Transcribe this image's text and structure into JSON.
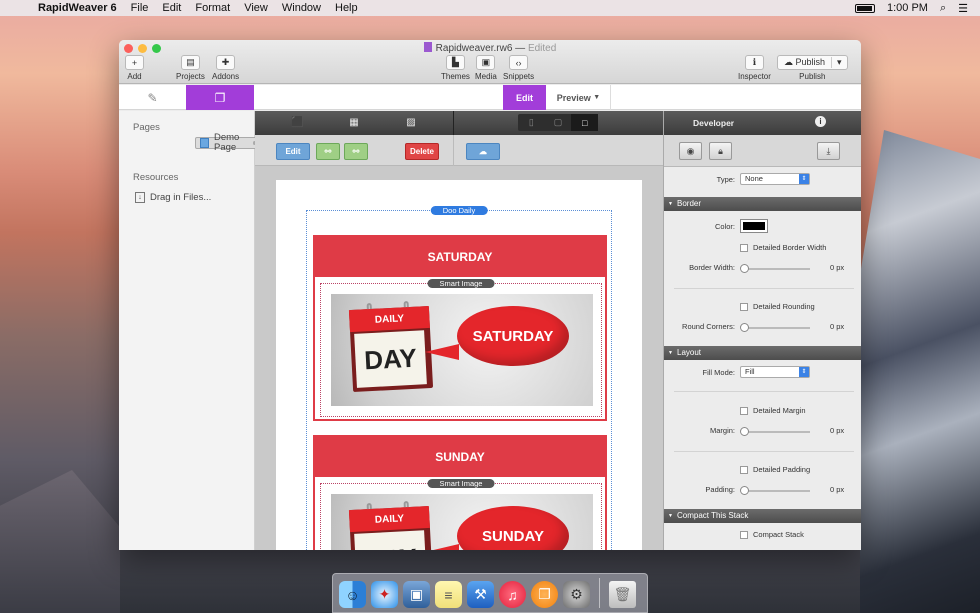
{
  "menubar": {
    "app_name": "RapidWeaver 6",
    "items": [
      "File",
      "Edit",
      "Format",
      "View",
      "Window",
      "Help"
    ],
    "clock": "1:00 PM"
  },
  "window": {
    "title": "Rapidweaver.rw6",
    "title_sep": "—",
    "edited": "Edited",
    "toolbar": {
      "add": "Add",
      "projects": "Projects",
      "addons": "Addons",
      "themes": "Themes",
      "media": "Media",
      "snippets": "Snippets",
      "inspector": "Inspector",
      "publish_button": "Publish",
      "publish_label": "Publish"
    },
    "mode_tabs": {
      "edit": "Edit",
      "preview": "Preview"
    }
  },
  "sidebar": {
    "pages_header": "Pages",
    "pages": [
      {
        "label": "Demo Page"
      }
    ],
    "resources_header": "Resources",
    "resources": [
      {
        "label": "Drag in Files..."
      }
    ]
  },
  "editor": {
    "actions": {
      "edit": "Edit",
      "delete": "Delete"
    },
    "stack_label": "Doo Daily",
    "cards": [
      {
        "title": "SATURDAY",
        "image_label": "Smart Image",
        "cal_top": "DAILY",
        "cal_word": "DAY",
        "bubble": "SATURDAY"
      },
      {
        "title": "SUNDAY",
        "image_label": "Smart Image",
        "cal_top": "DAILY",
        "cal_word": "DAY",
        "bubble": "SUNDAY"
      }
    ]
  },
  "inspector": {
    "header": "Developer",
    "type_label": "Type:",
    "type_value": "None",
    "border_section": "Border",
    "color_label": "Color:",
    "border_color": "#000000",
    "detailed_border_width": "Detailed Border Width",
    "border_width_label": "Border Width:",
    "border_width_value": "0 px",
    "detailed_rounding": "Detailed Rounding",
    "round_corners_label": "Round Corners:",
    "round_corners_value": "0 px",
    "layout_section": "Layout",
    "fill_mode_label": "Fill Mode:",
    "fill_mode_value": "Fill",
    "detailed_margin": "Detailed Margin",
    "margin_label": "Margin:",
    "margin_value": "0 px",
    "detailed_padding": "Detailed Padding",
    "padding_label": "Padding:",
    "padding_value": "0 px",
    "compact_section": "Compact This Stack",
    "compact_stack": "Compact Stack"
  },
  "colors": {
    "accent": "#a23dd9",
    "card_red": "#df3b46",
    "link_blue": "#2f7be0"
  }
}
